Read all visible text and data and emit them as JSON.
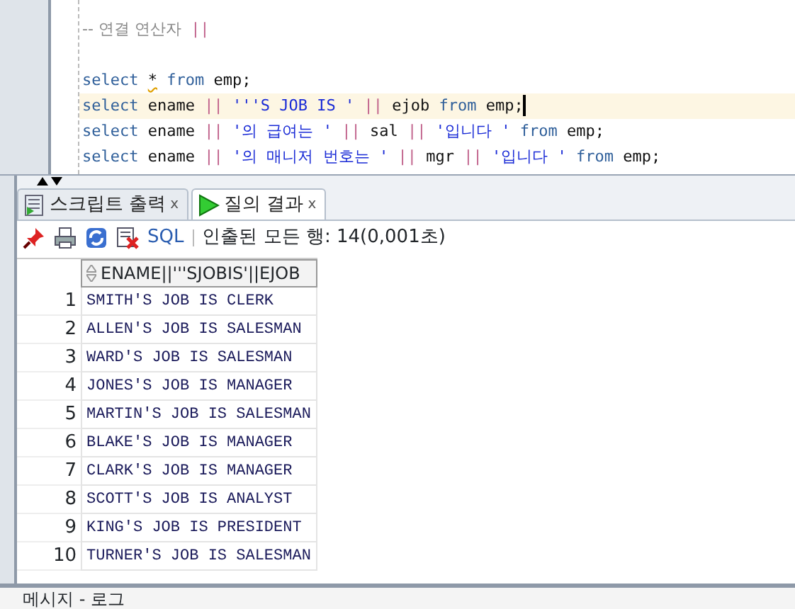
{
  "editor": {
    "lines": [
      {
        "current": false,
        "tokens": [
          {
            "kind": "comment",
            "text": "-- 연결 연산자"
          },
          {
            "kind": "op",
            "text": "||"
          }
        ]
      },
      {
        "current": false,
        "tokens": [
          {
            "kind": "keyword",
            "text": "select"
          },
          {
            "kind": "warn",
            "text": "*"
          },
          {
            "kind": "keyword",
            "text": "from"
          },
          {
            "kind": "plain",
            "text": "emp;"
          }
        ]
      },
      {
        "current": true,
        "tokens": [
          {
            "kind": "keyword",
            "text": "select"
          },
          {
            "kind": "plain",
            "text": "ename"
          },
          {
            "kind": "op",
            "text": "||"
          },
          {
            "kind": "string",
            "text": "'''S JOB IS '"
          },
          {
            "kind": "op",
            "text": "||"
          },
          {
            "kind": "plain",
            "text": "ejob"
          },
          {
            "kind": "keyword",
            "text": "from"
          },
          {
            "kind": "plain",
            "text": "emp;"
          }
        ]
      },
      {
        "current": false,
        "tokens": [
          {
            "kind": "keyword",
            "text": "select"
          },
          {
            "kind": "plain",
            "text": "ename"
          },
          {
            "kind": "op",
            "text": "||"
          },
          {
            "kind": "string",
            "text": "'의 급여는 '"
          },
          {
            "kind": "op",
            "text": "||"
          },
          {
            "kind": "plain",
            "text": "sal"
          },
          {
            "kind": "op",
            "text": "||"
          },
          {
            "kind": "string",
            "text": "'입니다 '"
          },
          {
            "kind": "keyword",
            "text": "from"
          },
          {
            "kind": "plain",
            "text": "emp;"
          }
        ]
      },
      {
        "current": false,
        "tokens": [
          {
            "kind": "keyword",
            "text": "select"
          },
          {
            "kind": "plain",
            "text": "ename"
          },
          {
            "kind": "op",
            "text": "||"
          },
          {
            "kind": "string",
            "text": "'의 매니저 번호는 '"
          },
          {
            "kind": "op",
            "text": "||"
          },
          {
            "kind": "plain",
            "text": "mgr"
          },
          {
            "kind": "op",
            "text": "||"
          },
          {
            "kind": "string",
            "text": "'입니다 '"
          },
          {
            "kind": "keyword",
            "text": "from"
          },
          {
            "kind": "plain",
            "text": "emp;"
          }
        ]
      }
    ]
  },
  "tabs": [
    {
      "label": "스크립트 출력",
      "selected": false,
      "close": "x"
    },
    {
      "label": "질의 결과",
      "selected": true,
      "close": "x"
    }
  ],
  "toolbar": {
    "sql": "SQL",
    "status": "인출된 모든 행: 14(0,001초)"
  },
  "grid": {
    "column": "ENAME||'''SJOBIS'||EJOB",
    "rows": [
      {
        "num": "1",
        "value": "SMITH'S JOB IS CLERK"
      },
      {
        "num": "2",
        "value": "ALLEN'S JOB IS SALESMAN"
      },
      {
        "num": "3",
        "value": "WARD'S JOB IS SALESMAN"
      },
      {
        "num": "4",
        "value": "JONES'S JOB IS MANAGER"
      },
      {
        "num": "5",
        "value": "MARTIN'S JOB IS SALESMAN"
      },
      {
        "num": "6",
        "value": "BLAKE'S JOB IS MANAGER"
      },
      {
        "num": "7",
        "value": "CLARK'S JOB IS MANAGER"
      },
      {
        "num": "8",
        "value": "SCOTT'S JOB IS ANALYST"
      },
      {
        "num": "9",
        "value": "KING'S JOB IS PRESIDENT"
      },
      {
        "num": "10",
        "value": "TURNER'S JOB IS SALESMAN"
      }
    ]
  },
  "bottom_panel": {
    "title": "메시지 - 로그"
  }
}
